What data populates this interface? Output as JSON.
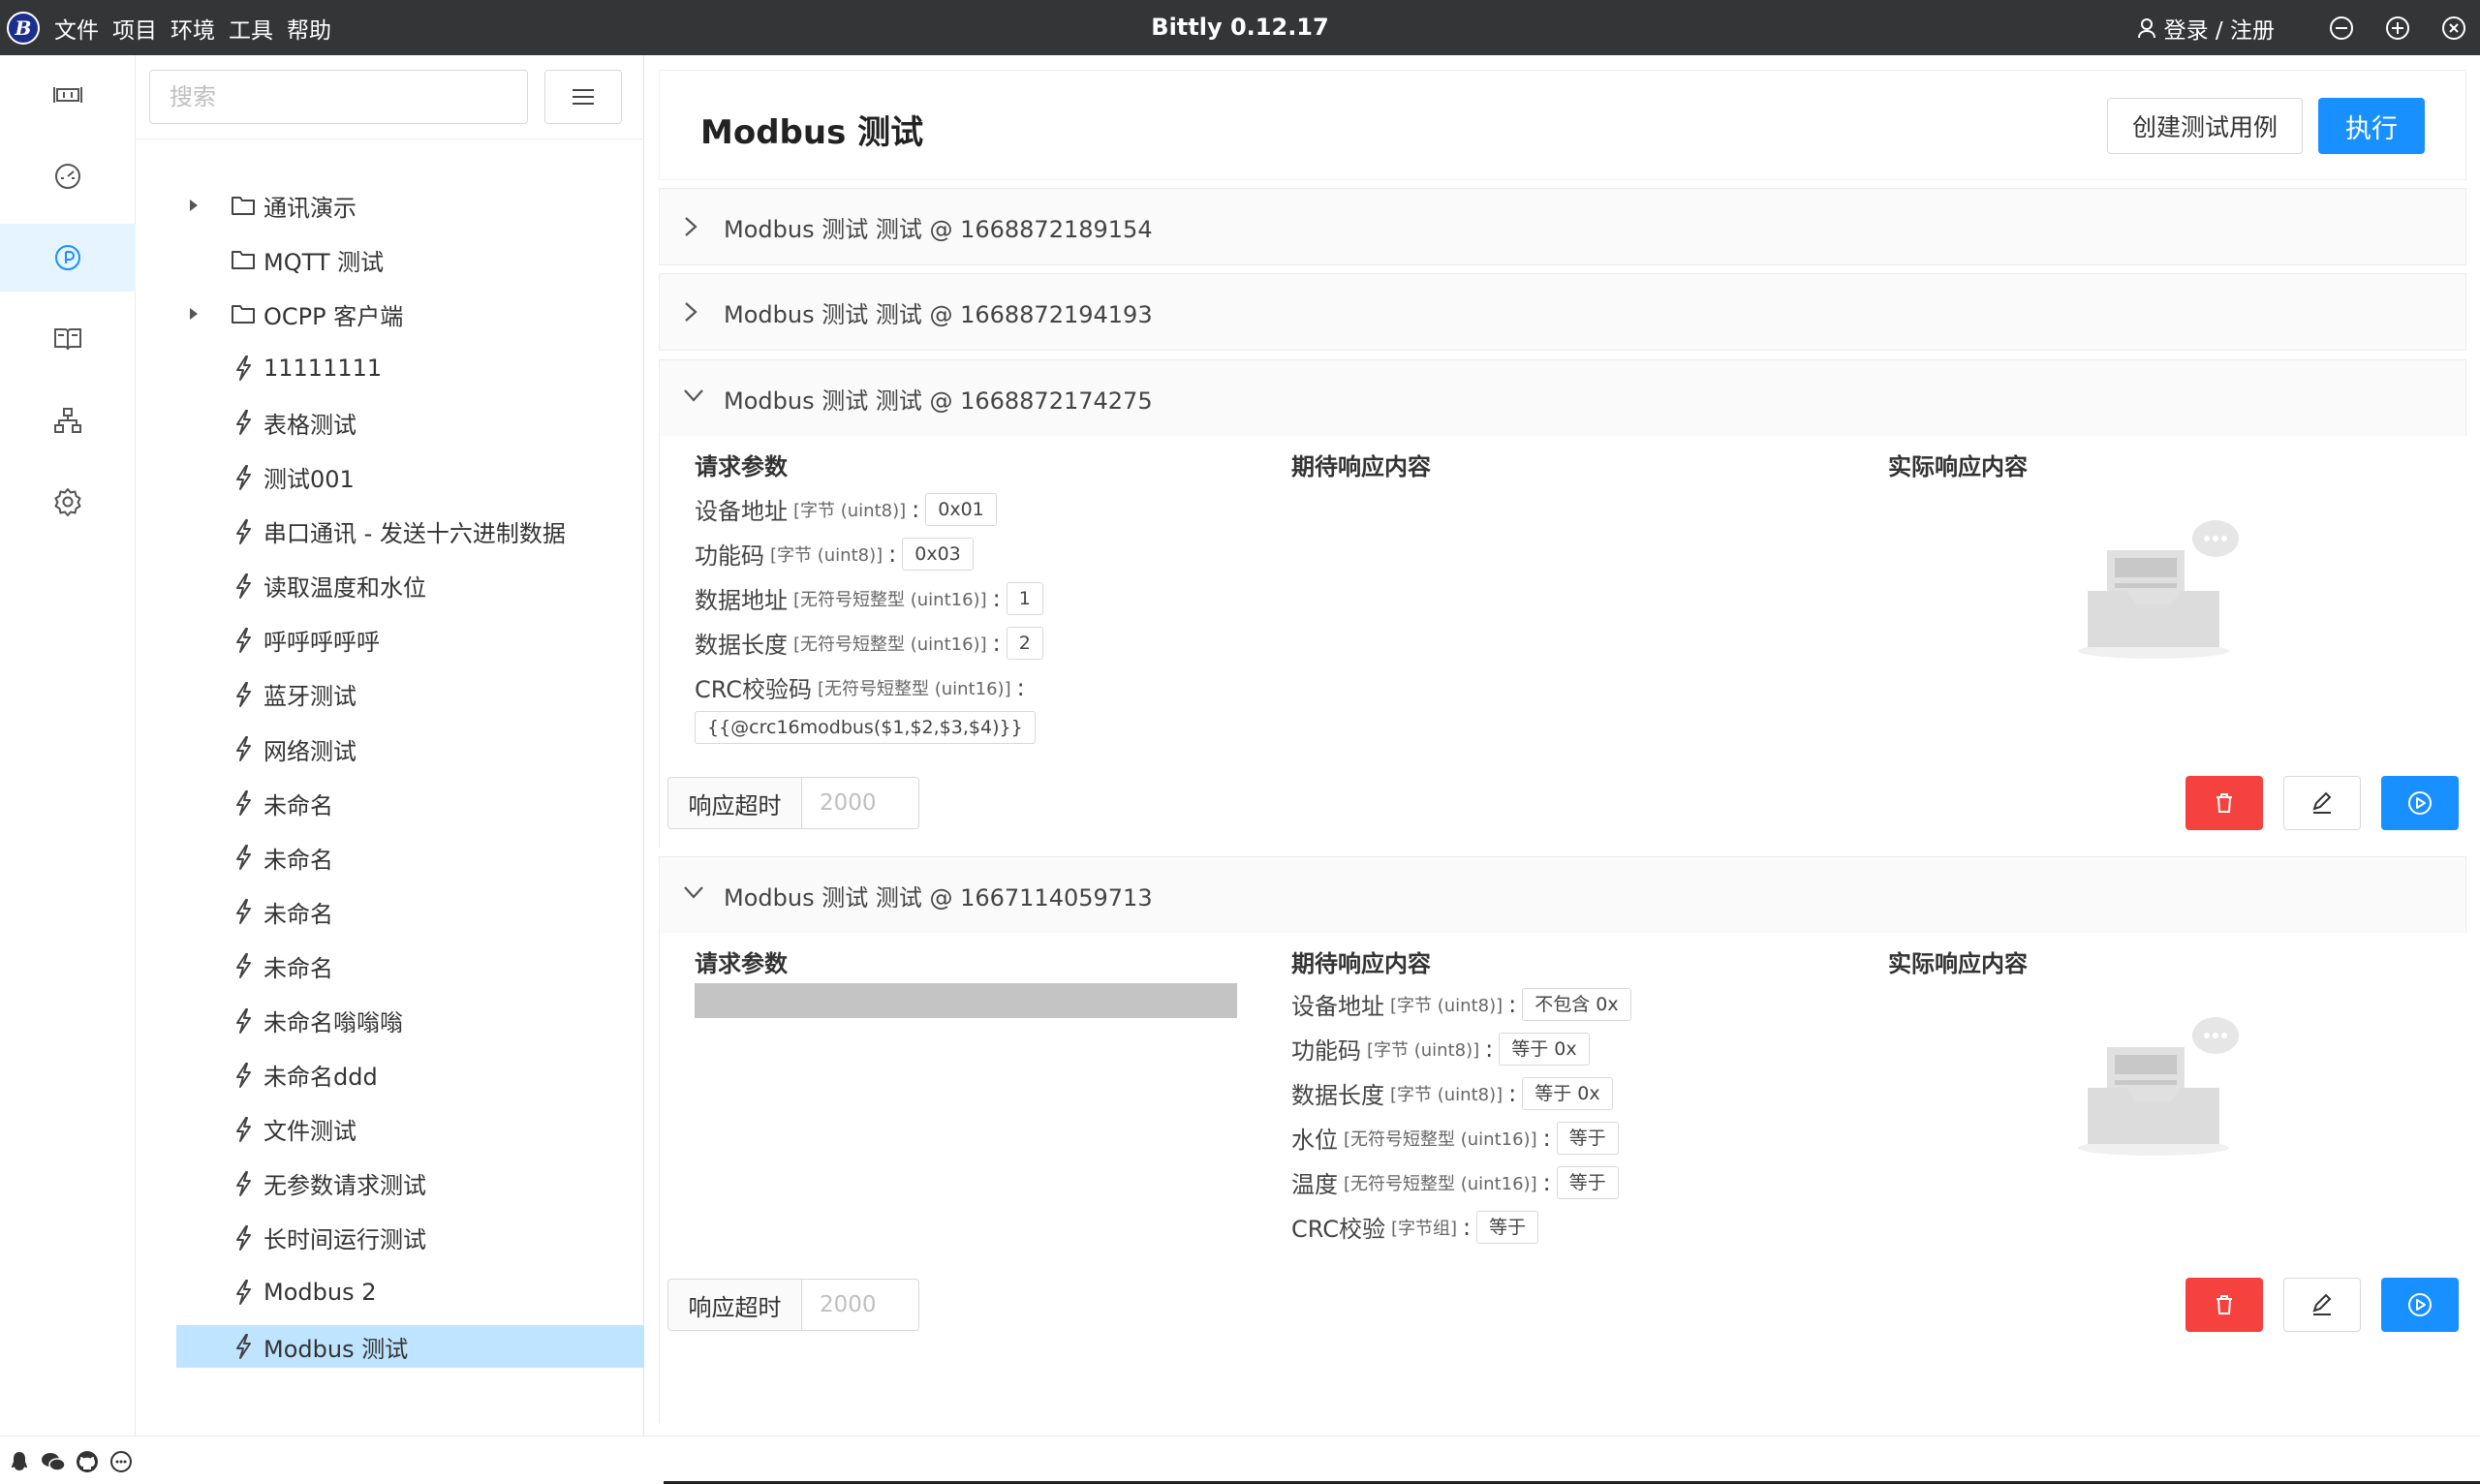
{
  "app": {
    "title": "Bittly 0.12.17",
    "logo_text": "B",
    "menu": [
      "文件",
      "项目",
      "环境",
      "工具",
      "帮助"
    ],
    "login_label": "登录 / 注册"
  },
  "sidebar_icons": [
    "serial-port-icon",
    "dashboard-icon",
    "test-icon",
    "docs-icon",
    "network-icon",
    "settings-icon"
  ],
  "tree": {
    "search_placeholder": "搜索",
    "items": [
      {
        "type": "folder",
        "label": "通讯演示",
        "expandable": true
      },
      {
        "type": "folder",
        "label": "MQTT 测试",
        "expandable": false
      },
      {
        "type": "folder",
        "label": "OCPP 客户端",
        "expandable": true
      },
      {
        "type": "request",
        "label": "11111111"
      },
      {
        "type": "request",
        "label": "表格测试"
      },
      {
        "type": "request",
        "label": "测试001"
      },
      {
        "type": "request",
        "label": "串口通讯 - 发送十六进制数据"
      },
      {
        "type": "request",
        "label": "读取温度和水位"
      },
      {
        "type": "request",
        "label": "呼呼呼呼呼"
      },
      {
        "type": "request",
        "label": "蓝牙测试"
      },
      {
        "type": "request",
        "label": "网络测试"
      },
      {
        "type": "request",
        "label": "未命名"
      },
      {
        "type": "request",
        "label": "未命名"
      },
      {
        "type": "request",
        "label": "未命名"
      },
      {
        "type": "request",
        "label": "未命名"
      },
      {
        "type": "request",
        "label": "未命名嗡嗡嗡"
      },
      {
        "type": "request",
        "label": "未命名ddd"
      },
      {
        "type": "request",
        "label": "文件测试"
      },
      {
        "type": "request",
        "label": "无参数请求测试"
      },
      {
        "type": "request",
        "label": "长时间运行测试"
      },
      {
        "type": "request",
        "label": "Modbus 2"
      },
      {
        "type": "request",
        "label": "Modbus 测试",
        "selected": true
      }
    ]
  },
  "main": {
    "title": "Modbus 测试",
    "create_button": "创建测试用例",
    "run_button": "执行",
    "cases": [
      {
        "title": "Modbus 测试 测试 @ 1668872189154",
        "expanded": false
      },
      {
        "title": "Modbus 测试 测试 @ 1668872194193",
        "expanded": false
      },
      {
        "title": "Modbus 测试 测试 @ 1668872174275",
        "expanded": true,
        "request_title": "请求参数",
        "expected_title": "期待响应内容",
        "actual_title": "实际响应内容",
        "params": [
          {
            "name": "设备地址",
            "type": "[字节 (uint8)]",
            "value": "0x01"
          },
          {
            "name": "功能码",
            "type": "[字节 (uint8)]",
            "value": "0x03"
          },
          {
            "name": "数据地址",
            "type": "[无符号短整型 (uint16)]",
            "value": "1"
          },
          {
            "name": "数据长度",
            "type": "[无符号短整型 (uint16)]",
            "value": "2"
          },
          {
            "name": "CRC校验码",
            "type": "[无符号短整型 (uint16)]",
            "value": "{{@crc16modbus($1,$2,$3,$4)}}"
          }
        ],
        "timeout_label": "响应超时",
        "timeout_value": "2000"
      },
      {
        "title": "Modbus 测试 测试 @ 1667114059713",
        "expanded": true,
        "request_title": "请求参数",
        "expected_title": "期待响应内容",
        "actual_title": "实际响应内容",
        "expected": [
          {
            "name": "设备地址",
            "type": "[字节 (uint8)]",
            "value": "不包含 0x"
          },
          {
            "name": "功能码",
            "type": "[字节 (uint8)]",
            "value": "等于 0x"
          },
          {
            "name": "数据长度",
            "type": "[字节 (uint8)]",
            "value": "等于 0x"
          },
          {
            "name": "水位",
            "type": "[无符号短整型 (uint16)]",
            "value": "等于"
          },
          {
            "name": "温度",
            "type": "[无符号短整型 (uint16)]",
            "value": "等于"
          },
          {
            "name": "CRC校验",
            "type": "[字节组]",
            "value": "等于"
          }
        ],
        "timeout_label": "响应超时",
        "timeout_value": "2000"
      }
    ]
  },
  "colors": {
    "titlebar": "#333537",
    "primary": "#1890ff",
    "danger": "#f5423f",
    "selected_row": "#bfe4ff",
    "rail_active": "#e6f4ff"
  }
}
